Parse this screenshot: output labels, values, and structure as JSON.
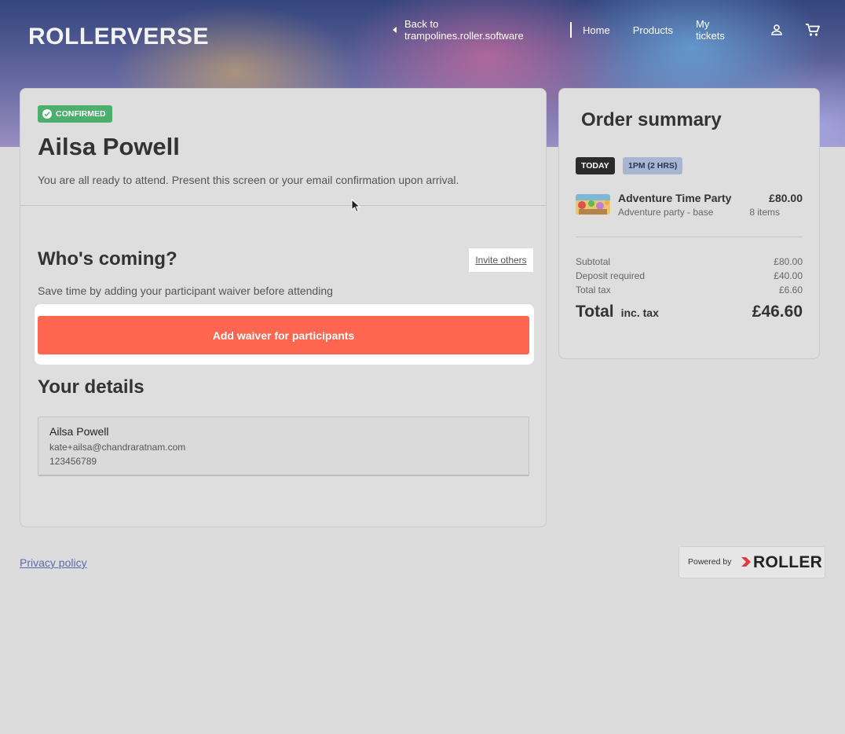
{
  "header": {
    "logo": "ROLLERVERSE",
    "back_link": "Back to trampolines.roller.software",
    "nav": [
      "Home",
      "Products",
      "My tickets"
    ],
    "icons": [
      "account-icon",
      "cart-icon"
    ]
  },
  "booking": {
    "status_badge": "CONFIRMED",
    "name": "Ailsa Powell",
    "ready_message": "You are all ready to attend. Present this screen or your email confirmation upon arrival.",
    "whos_coming_title": "Who's coming?",
    "invite_label": "Invite others",
    "waiver_note": "Save time by adding your participant waiver before attending",
    "waiver_button": "Add waiver for participants",
    "details_title": "Your details",
    "details": {
      "name": "Ailsa Powell",
      "email": "kate+ailsa@chandraratnam.com",
      "phone": "123456789"
    }
  },
  "summary": {
    "title": "Order summary",
    "day_chip": "TODAY",
    "time_chip": "1PM (2 HRS)",
    "item": {
      "name": "Adventure Time Party",
      "price": "£80.00",
      "subtitle": "Adventure party - base",
      "count": "8 items"
    },
    "rows": [
      {
        "label": "Subtotal",
        "value": "£80.00"
      },
      {
        "label": "Deposit required",
        "value": "£40.00"
      },
      {
        "label": "Total tax",
        "value": "£6.60"
      }
    ],
    "total_label": "Total",
    "total_suffix": "inc. tax",
    "total_value": "£46.60"
  },
  "footer": {
    "privacy": "Privacy policy",
    "powered_by": "Powered by",
    "brand": "ROLLER"
  },
  "colors": {
    "confirmed": "#4caf6e",
    "primary_button": "#ff6650",
    "time_chip": "#a9b6d1",
    "today_chip": "#2b2b2b"
  }
}
